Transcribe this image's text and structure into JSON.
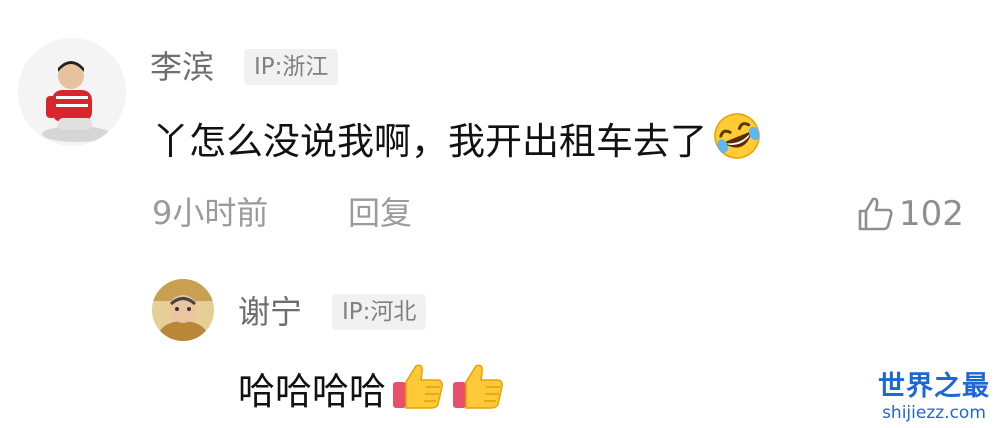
{
  "comment": {
    "author": "李滨",
    "ip_label": "IP:浙江",
    "text": "丫怎么没说我啊，我开出租车去了",
    "text_emoji": "rofl-emoji",
    "time": "9小时前",
    "reply_label": "回复",
    "like_icon": "thumbs-up-outline-icon",
    "like_count": "102"
  },
  "reply": {
    "author": "谢宁",
    "ip_label": "IP:河北",
    "text": "哈哈哈哈",
    "text_emojis": [
      "thumbs-up-emoji",
      "thumbs-up-emoji"
    ]
  },
  "watermark": {
    "title": "世界之最",
    "url": "shijiezz.com"
  },
  "colors": {
    "name": "#6e6e6e",
    "ip_badge_bg": "#f1f1f1",
    "content": "#111111",
    "meta": "#9b9b9b",
    "watermark": "#1f66d6"
  }
}
